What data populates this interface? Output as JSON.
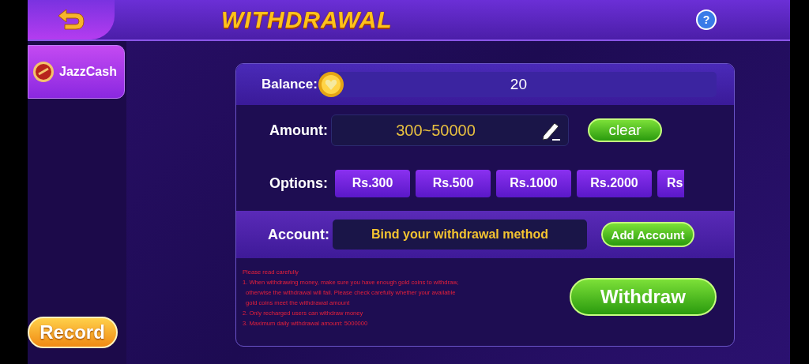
{
  "header": {
    "title": "WITHDRAWAL",
    "help": "?"
  },
  "sidebar": {
    "items": [
      {
        "label": "JazzCash",
        "selected": true
      }
    ],
    "record_button": "Record"
  },
  "balance": {
    "label": "Balance:",
    "value": "20"
  },
  "amount": {
    "label": "Amount:",
    "placeholder": "300~50000",
    "clear_button": "clear"
  },
  "options": {
    "label": "Options:",
    "items": [
      {
        "label": "Rs.300"
      },
      {
        "label": "Rs.500"
      },
      {
        "label": "Rs.1000"
      },
      {
        "label": "Rs.2000"
      },
      {
        "label": "Rs"
      }
    ]
  },
  "account": {
    "label": "Account:",
    "value": "Bind your withdrawal method",
    "add_button": "Add Account"
  },
  "notice": {
    "lines": [
      "Please read carefully",
      "1. When withdrawing money, make sure you have enough gold coins to withdraw,",
      "otherwise the withdrawal will fail. Please check carefully whether your available",
      "gold coins meet the withdrawal amount",
      "2. Only recharged users can withdraw money",
      "3. Maximum daily withdrawal amount: 5000000"
    ]
  },
  "withdraw_button": "Withdraw"
}
